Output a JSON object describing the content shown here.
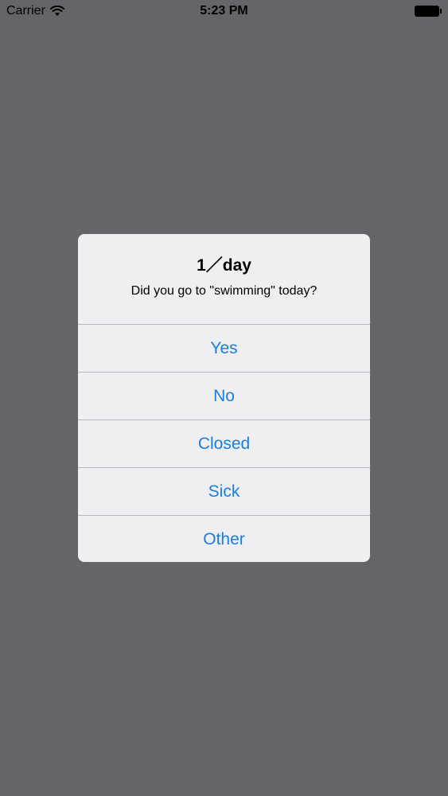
{
  "status_bar": {
    "carrier": "Carrier",
    "time": "5:23 PM",
    "wifi_icon": "wifi-icon",
    "battery_icon": "battery-icon"
  },
  "alert": {
    "title": "1／day",
    "message": "Did you go to \"swimming\" today?",
    "buttons": [
      {
        "label": "Yes"
      },
      {
        "label": "No"
      },
      {
        "label": "Closed"
      },
      {
        "label": "Sick"
      },
      {
        "label": "Other"
      }
    ],
    "button_color": "#1a7ee0"
  }
}
